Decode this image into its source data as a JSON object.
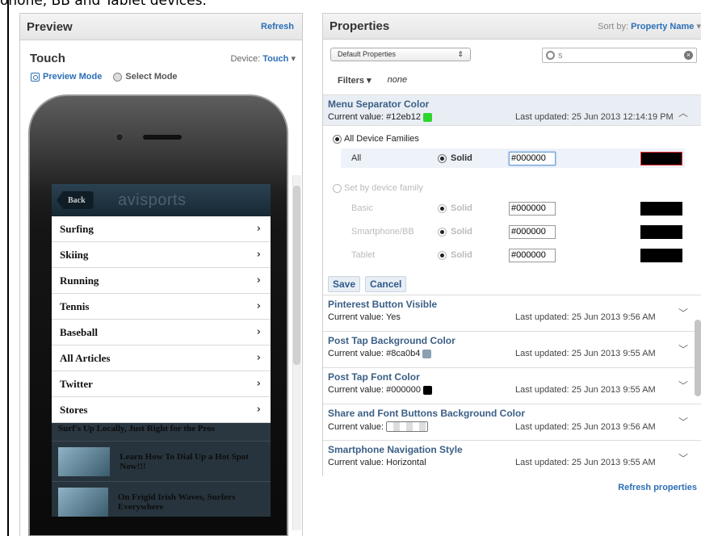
{
  "caption": "ohone, BB and Tablet devices.",
  "preview": {
    "title": "Preview",
    "refresh_label": "Refresh",
    "device_title": "Touch",
    "device_label": "Device:",
    "device_value": "Touch",
    "preview_mode_label": "Preview Mode",
    "select_mode_label": "Select Mode",
    "phone": {
      "back_label": "Back",
      "logo_text": "avisports",
      "menu": [
        "Surfing",
        "Skiing",
        "Running",
        "Tennis",
        "Baseball",
        "All Articles",
        "Twitter",
        "Stores"
      ],
      "teaser_text": "Surf's Up Locally, Just Right for the Pros",
      "articles": [
        "Learn How To Dial Up a Hot Spot Now!!!",
        "On Frigid Irish Waves, Surfers Everywhere"
      ]
    }
  },
  "properties": {
    "title": "Properties",
    "sort_label": "Sort by:",
    "sort_value": "Property Name",
    "select_value": "Default Properties",
    "search_value": "s",
    "filters_label": "Filters",
    "filters_value": "none",
    "expanded": {
      "name": "Menu Separator Color",
      "current": "Current value: #12eb12",
      "swatch": "#2dd62d",
      "updated": "Last updated: 25 Jun 2013 12:14:19 PM",
      "all_families_label": "All Device Families",
      "all_row_name": "All",
      "solid_label": "Solid",
      "all_hex": "#000000",
      "by_family_label": "Set by device family",
      "families": [
        {
          "name": "Basic",
          "hex": "#000000"
        },
        {
          "name": "Smartphone/BB",
          "hex": "#000000"
        },
        {
          "name": "Tablet",
          "hex": "#000000"
        }
      ],
      "save_label": "Save",
      "cancel_label": "Cancel"
    },
    "items": [
      {
        "name": "Pinterest Button Visible",
        "current": "Current value: Yes",
        "updated": "Last updated: 25 Jun 2013 9:56 AM",
        "swatch": ""
      },
      {
        "name": "Post Tap Background Color",
        "current": "Current value: #8ca0b4",
        "updated": "Last updated: 25 Jun 2013 9:55 AM",
        "swatch": "#8ca0b4"
      },
      {
        "name": "Post Tap Font Color",
        "current": "Current value: #000000",
        "updated": "Last updated: 25 Jun 2013 9:55 AM",
        "swatch": "#000000"
      },
      {
        "name": "Share and Font Buttons Background Color",
        "current": "Current value:",
        "updated": "Last updated: 25 Jun 2013 9:56 AM",
        "swatch": "transparent"
      },
      {
        "name": "Smartphone Navigation Style",
        "current": "Current value: Horizontal",
        "updated": "Last updated: 25 Jun 2013 9:55 AM",
        "swatch": ""
      }
    ],
    "refresh_properties_label": "Refresh properties"
  }
}
